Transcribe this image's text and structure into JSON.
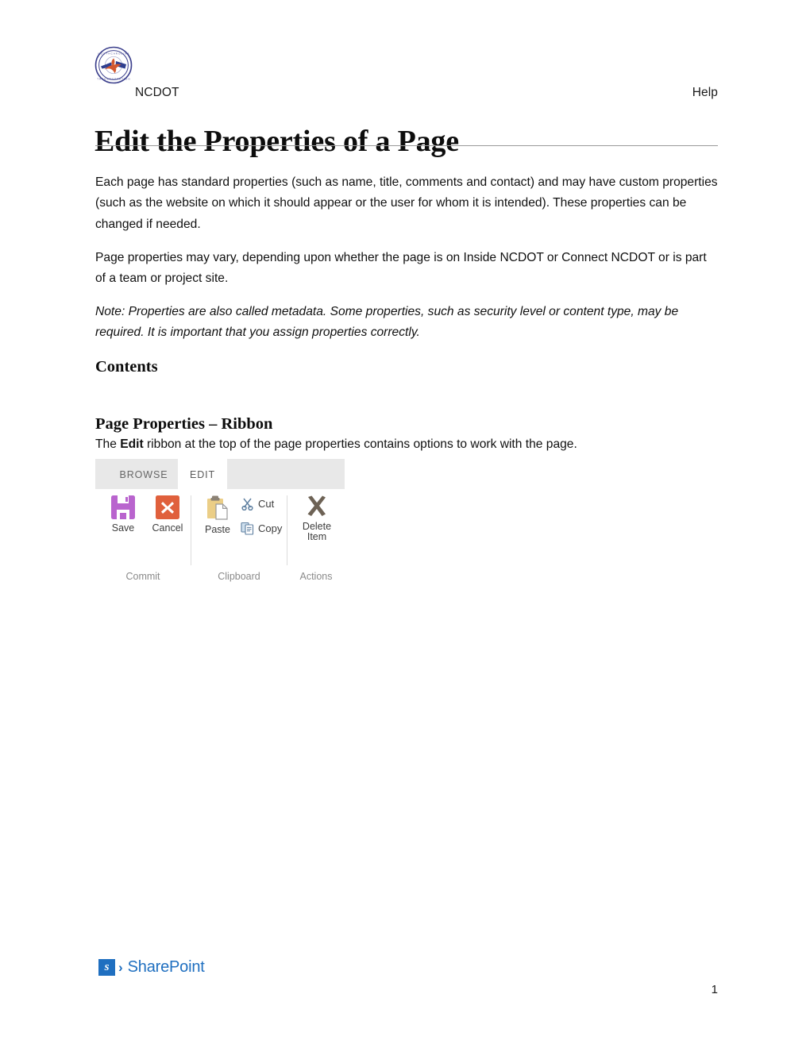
{
  "document": {
    "organization": "NCDOT",
    "help_link": "Help",
    "title": "Edit the Properties of a Page",
    "page_number": "1",
    "footer_brand": {
      "mark_letter": "s",
      "chevron": "›",
      "wordmark": "SharePoint"
    }
  },
  "body": {
    "paragraph_1": "Each page has standard properties (such as name, title, comments and contact) and may have custom properties (such as the website on which it should appear or the user for whom it is intended). These properties can be changed if needed.",
    "paragraph_2": "Page properties may vary, depending upon whether the page is on Inside NCDOT or Connect NCDOT or is part of a team or project site.",
    "paragraph_3_note": "Note: Properties are also called metadata. Some properties, such as security level or content type, may be required. It is important that you assign properties correctly.",
    "contents_heading": "Contents",
    "section_heading": "Page Properties – Ribbon",
    "section_intro_before": "The ",
    "section_intro_bold": "Edit",
    "section_intro_after": " ribbon at the top of the page properties contains options to work with the page."
  },
  "ribbon": {
    "tabs": [
      {
        "label": "BROWSE",
        "active": false
      },
      {
        "label": "EDIT",
        "active": true
      }
    ],
    "groups": [
      {
        "name": "Commit",
        "label": "Commit",
        "buttons": [
          {
            "label": "Save",
            "icon": "floppy-disk-icon",
            "color": "#B964CE"
          },
          {
            "label": "Cancel",
            "icon": "cancel-x-icon",
            "color": "#E0603C"
          }
        ]
      },
      {
        "name": "Clipboard",
        "label": "Clipboard",
        "buttons": [
          {
            "label": "Paste",
            "icon": "clipboard-icon",
            "color": "#EBCE87"
          },
          {
            "label": "Cut",
            "icon": "scissors-icon",
            "color": "#5E7FA0"
          },
          {
            "label": "Copy",
            "icon": "copy-documents-icon",
            "color": "#5E7FA0"
          }
        ]
      },
      {
        "name": "Actions",
        "label": "Actions",
        "buttons": [
          {
            "label_line1": "Delete",
            "label_line2": "Item",
            "icon": "delete-x-icon",
            "color": "#6D6255"
          }
        ]
      }
    ]
  },
  "colors": {
    "tabbar_background": "#E8E8E8",
    "active_tab_background": "#FFFFFF",
    "rule": "#9A9A9A",
    "sharepoint_blue": "#1F6FC0"
  }
}
